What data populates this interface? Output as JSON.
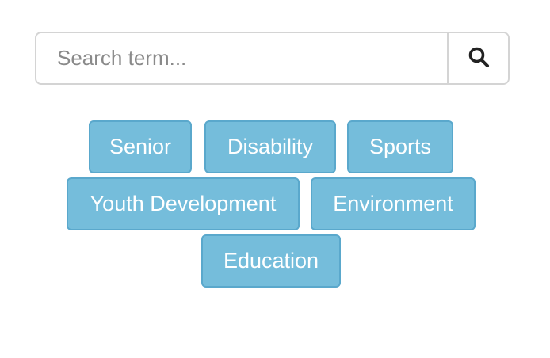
{
  "search": {
    "placeholder": "Search term...",
    "value": "",
    "button_icon": "search-icon"
  },
  "tags": [
    {
      "label": "Senior"
    },
    {
      "label": "Disability"
    },
    {
      "label": "Sports"
    },
    {
      "label": "Youth Development"
    },
    {
      "label": "Environment"
    },
    {
      "label": "Education"
    }
  ],
  "colors": {
    "tag_background": "#75bddb",
    "tag_border": "#5aa8cc",
    "tag_text": "#ffffff",
    "search_border": "#d4d4d4"
  }
}
